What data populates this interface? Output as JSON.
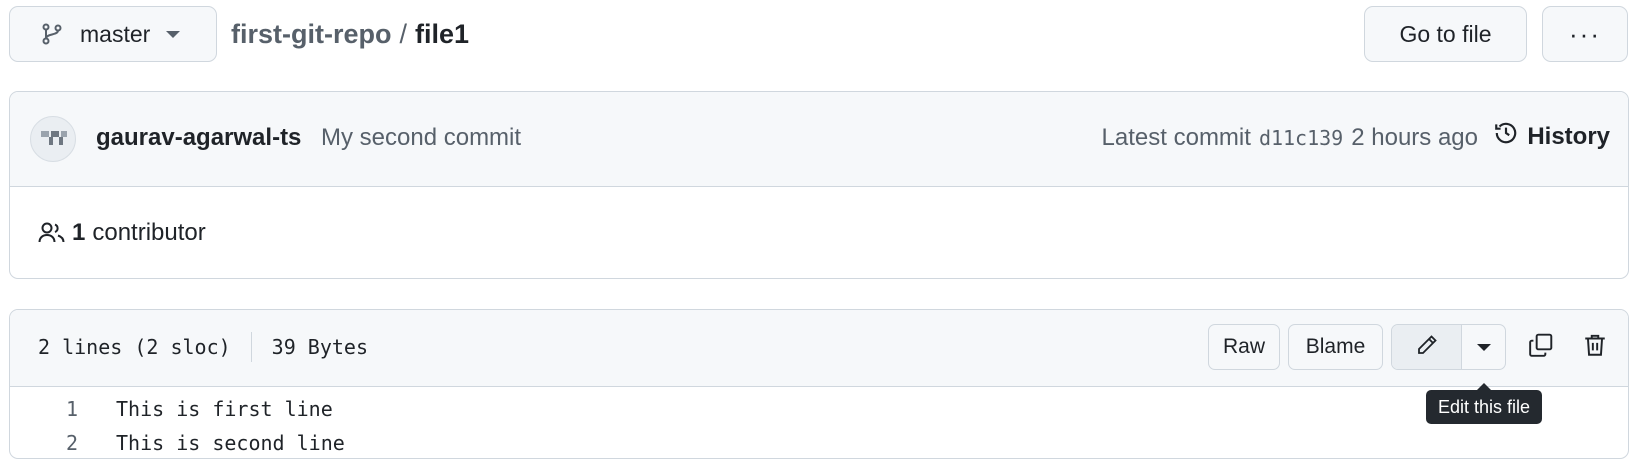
{
  "top_bar": {
    "branch_label": "master",
    "branch_icon": "git-branch-icon",
    "repo_name": "first-git-repo",
    "separator": "/",
    "file_name": "file1",
    "go_to_file_label": "Go to file",
    "more_label": "···"
  },
  "commit": {
    "author": "gaurav-agarwal-ts",
    "message": "My second commit",
    "latest_label": "Latest commit",
    "sha": "d11c139",
    "time": "2 hours ago",
    "history_label": "History",
    "history_icon": "history-icon"
  },
  "contributors": {
    "icon": "people-icon",
    "count": "1",
    "label": "contributor"
  },
  "file": {
    "lines_info": "2 lines (2 sloc)",
    "size": "39 Bytes",
    "raw_label": "Raw",
    "blame_label": "Blame",
    "edit_icon": "pencil-icon",
    "copy_icon": "copy-icon",
    "delete_icon": "trash-icon",
    "lines": [
      {
        "number": "1",
        "content": "This is first line"
      },
      {
        "number": "2",
        "content": "This is second line"
      }
    ]
  },
  "tooltip": {
    "text": "Edit this file"
  },
  "colors": {
    "text": "#1f2328",
    "muted": "#57606a",
    "border": "#d0d7de",
    "subtle_bg": "#f6f8fa",
    "tooltip_bg": "#24292f"
  }
}
